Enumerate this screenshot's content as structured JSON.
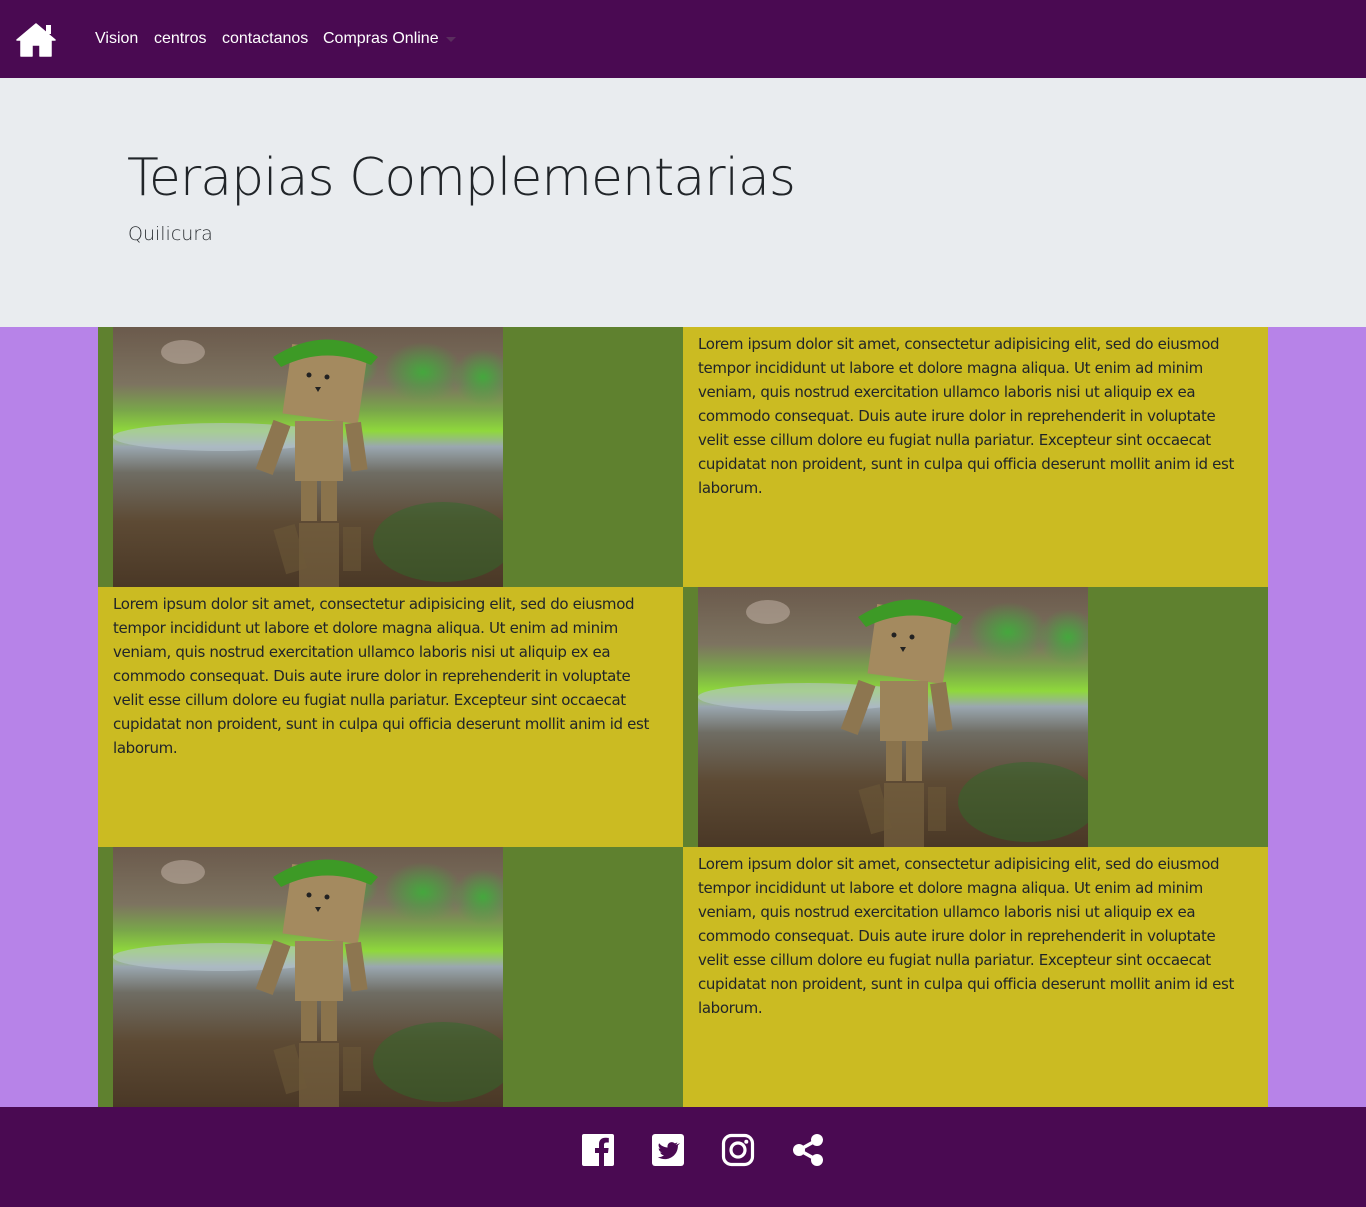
{
  "nav": {
    "home_icon": "home-icon",
    "links": [
      "Vision",
      "centros",
      "contactanos",
      "Compras Online"
    ],
    "dropdown_icon": "caret-down-icon"
  },
  "hero": {
    "title": "Terapias Complementarias",
    "subtitle": "Quilicura"
  },
  "rows": [
    {
      "image": "danbo-robot-leaf-photo",
      "text": "Lorem ipsum dolor sit amet, consectetur adipisicing elit, sed do eiusmod tempor incididunt ut labore et dolore magna aliqua. Ut enim ad minim veniam, quis nostrud exercitation ullamco laboris nisi ut aliquip ex ea commodo consequat. Duis aute irure dolor in reprehenderit in voluptate velit esse cillum dolore eu fugiat nulla pariatur. Excepteur sint occaecat cupidatat non proident, sunt in culpa qui officia deserunt mollit anim id est laborum."
    },
    {
      "image": "danbo-robot-leaf-photo",
      "text": "Lorem ipsum dolor sit amet, consectetur adipisicing elit, sed do eiusmod tempor incididunt ut labore et dolore magna aliqua. Ut enim ad minim veniam, quis nostrud exercitation ullamco laboris nisi ut aliquip ex ea commodo consequat. Duis aute irure dolor in reprehenderit in voluptate velit esse cillum dolore eu fugiat nulla pariatur. Excepteur sint occaecat cupidatat non proident, sunt in culpa qui officia deserunt mollit anim id est laborum."
    },
    {
      "image": "danbo-robot-leaf-photo",
      "text": "Lorem ipsum dolor sit amet, consectetur adipisicing elit, sed do eiusmod tempor incididunt ut labore et dolore magna aliqua. Ut enim ad minim veniam, quis nostrud exercitation ullamco laboris nisi ut aliquip ex ea commodo consequat. Duis aute irure dolor in reprehenderit in voluptate velit esse cillum dolore eu fugiat nulla pariatur. Excepteur sint occaecat cupidatat non proident, sunt in culpa qui officia deserunt mollit anim id est laborum."
    }
  ],
  "footer": {
    "social_icons": [
      "facebook-icon",
      "twitter-icon",
      "instagram-icon",
      "share-icon"
    ]
  },
  "colors": {
    "nav_bg": "#4a0a52",
    "jumbotron_bg": "#e9ecef",
    "page_bg": "#b783e8",
    "image_cell_bg": "#5f812f",
    "text_cell_bg": "#cbbb22"
  }
}
